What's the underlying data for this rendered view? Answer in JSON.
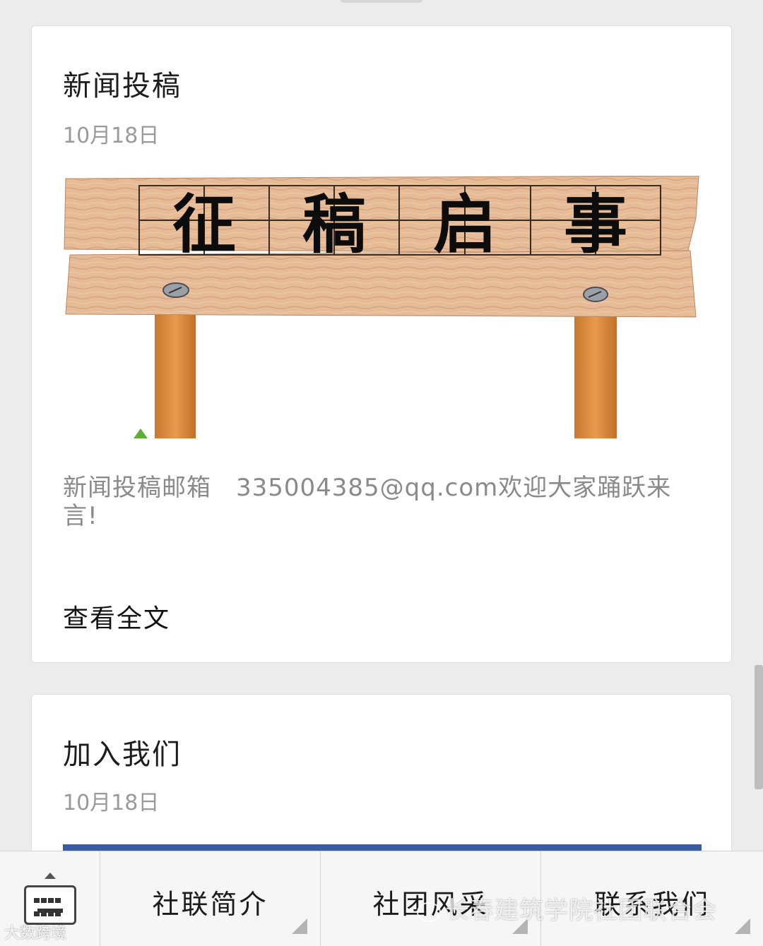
{
  "articles": [
    {
      "title": "新闻投稿",
      "date": "10月18日",
      "cover_text": [
        "征",
        "稿",
        "启",
        "事"
      ],
      "excerpt": "新闻投稿邮箱　335004385@qq.com欢迎大家踊跃来言!",
      "read_more": "查看全文"
    },
    {
      "title": "加入我们",
      "date": "10月18日"
    }
  ],
  "bottom_menu": {
    "keyboard_icon": "keyboard-icon",
    "items": [
      {
        "label": "社联简介"
      },
      {
        "label": "社团风采"
      },
      {
        "label": "联系我们"
      }
    ]
  },
  "watermarks": {
    "left": "大数跨境",
    "right": "长春建筑学院社团联合会"
  },
  "colors": {
    "background": "#ececec",
    "card": "#ffffff",
    "wood": "#e3b996",
    "post": "#d98a3c",
    "second_cover": "#3c5aa0"
  }
}
